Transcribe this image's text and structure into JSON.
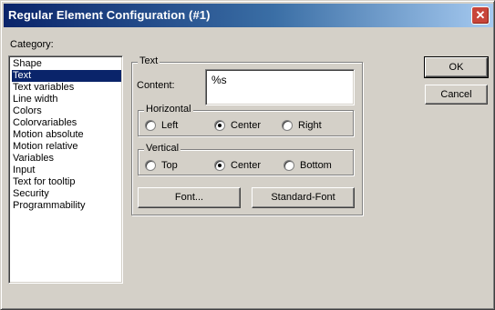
{
  "window": {
    "title": "Regular Element Configuration (#1)"
  },
  "category": {
    "label": "Category:",
    "items": [
      "Shape",
      "Text",
      "Text variables",
      "Line width",
      "Colors",
      "Colorvariables",
      "Motion absolute",
      "Motion relative",
      "Variables",
      "Input",
      "Text for tooltip",
      "Security",
      "Programmability"
    ],
    "selected": "Text"
  },
  "text_group": {
    "legend": "Text",
    "content_label": "Content:",
    "content_value": "%s"
  },
  "horizontal": {
    "legend": "Horizontal",
    "options": [
      "Left",
      "Center",
      "Right"
    ],
    "selected": "Center"
  },
  "vertical": {
    "legend": "Vertical",
    "options": [
      "Top",
      "Center",
      "Bottom"
    ],
    "selected": "Center"
  },
  "buttons": {
    "font": "Font...",
    "standard_font": "Standard-Font",
    "ok": "OK",
    "cancel": "Cancel"
  },
  "colors": {
    "selection": "#0a246a",
    "dialog_bg": "#d4d0c8",
    "titlebar_start": "#0a246a",
    "titlebar_end": "#a6caf0",
    "close_button": "#c8453a"
  }
}
